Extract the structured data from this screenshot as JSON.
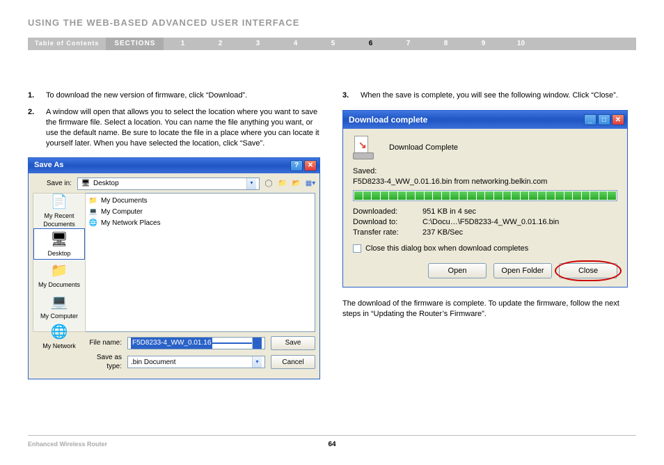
{
  "page_title": "USING THE WEB-BASED ADVANCED USER INTERFACE",
  "nav": {
    "toc": "Table of Contents",
    "sections": "SECTIONS",
    "nums": [
      "1",
      "2",
      "3",
      "4",
      "5",
      "6",
      "7",
      "8",
      "9",
      "10"
    ],
    "active": "6"
  },
  "left": {
    "step1_num": "1.",
    "step1": "To download the new version of firmware, click “Download”.",
    "step2_num": "2.",
    "step2": "A window will open that allows you to select the location where you want to save the firmware file. Select a location. You can name the file anything you want, or use the default name. Be sure to locate the file in a place where you can locate it yourself later. When you have selected the location, click “Save”."
  },
  "saveas": {
    "title": "Save As",
    "savein_label": "Save in:",
    "savein_value": "Desktop",
    "places": {
      "recent": "My Recent Documents",
      "desktop": "Desktop",
      "mydocs": "My Documents",
      "mycomp": "My Computer",
      "mynet": "My Network"
    },
    "files": {
      "mydocs": "My Documents",
      "mycomp": "My Computer",
      "mynet": "My Network Places"
    },
    "filename_label": "File name:",
    "filename_value": "F5D8233-4_WW_0.01.16",
    "savetype_label": "Save as type:",
    "savetype_value": ".bin Document",
    "save_btn": "Save",
    "cancel_btn": "Cancel"
  },
  "right": {
    "step3_num": "3.",
    "step3": "When the save is complete, you will see the following window. Click “Close”.",
    "after": "The download of the firmware is complete. To update the firmware, follow the next steps in “Updating the Router’s Firmware”."
  },
  "dlc": {
    "title": "Download complete",
    "heading": "Download Complete",
    "saved_label": "Saved:",
    "saved_value": "F5D8233-4_WW_0.01.16.bin from networking.belkin.com",
    "downloaded_label": "Downloaded:",
    "downloaded_value": "951 KB in 4 sec",
    "downloadto_label": "Download to:",
    "downloadto_value": "C:\\Docu…\\F5D8233-4_WW_0.01.16.bin",
    "rate_label": "Transfer rate:",
    "rate_value": "237 KB/Sec",
    "checkbox": "Close this dialog box when download completes",
    "open_btn": "Open",
    "openfolder_btn": "Open Folder",
    "close_btn": "Close"
  },
  "footer": {
    "product": "Enhanced Wireless Router",
    "page": "64"
  }
}
